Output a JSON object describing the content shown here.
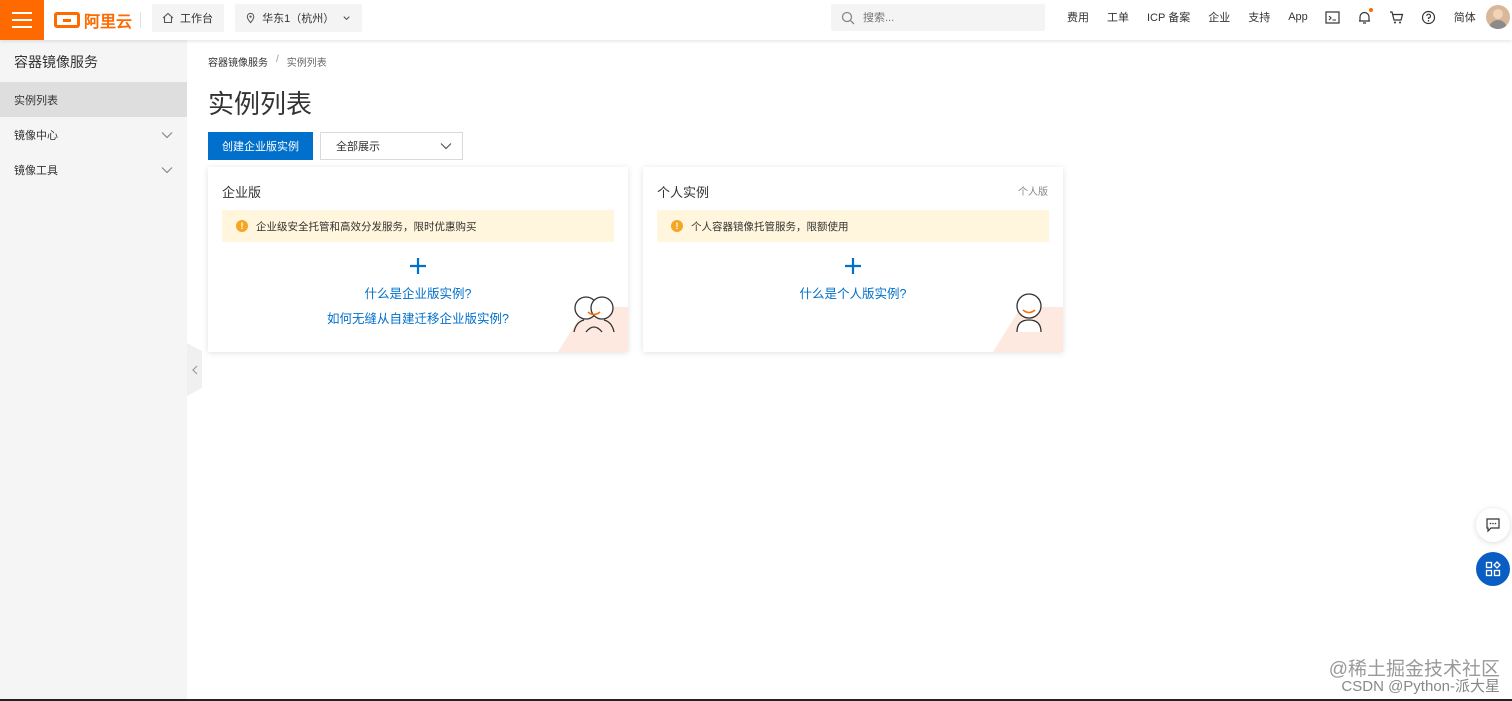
{
  "topbar": {
    "logo_text": "阿里云",
    "workbench_label": "工作台",
    "region_label": "华东1（杭州）",
    "search_placeholder": "搜索...",
    "nav": [
      "费用",
      "工单",
      "ICP 备案",
      "企业",
      "支持",
      "App"
    ],
    "lang_label": "简体",
    "icons": [
      "terminal-icon",
      "bell-icon",
      "cart-icon",
      "help-icon"
    ],
    "accent_color": "#ff6a00"
  },
  "sidebar": {
    "title": "容器镜像服务",
    "items": [
      {
        "label": "实例列表",
        "active": true
      },
      {
        "label": "镜像中心",
        "expandable": true
      },
      {
        "label": "镜像工具",
        "expandable": true
      }
    ]
  },
  "main": {
    "breadcrumb": [
      "容器镜像服务",
      "实例列表"
    ],
    "title": "实例列表",
    "create_button": "创建企业版实例",
    "filter_value": "全部展示",
    "primary_color": "#0070cc",
    "cards": [
      {
        "title": "企业版",
        "tag": "",
        "notice": "企业级安全托管和高效分发服务，限时优惠购买",
        "links": [
          "什么是企业版实例?",
          "如何无缝从自建迁移企业版实例?"
        ]
      },
      {
        "title": "个人实例",
        "tag": "个人版",
        "notice": "个人容器镜像托管服务，限额使用",
        "links": [
          "什么是个人版实例?"
        ]
      }
    ]
  },
  "watermark": {
    "line1": "@稀土掘金技术社区",
    "line2": "CSDN @Python-派大星"
  }
}
